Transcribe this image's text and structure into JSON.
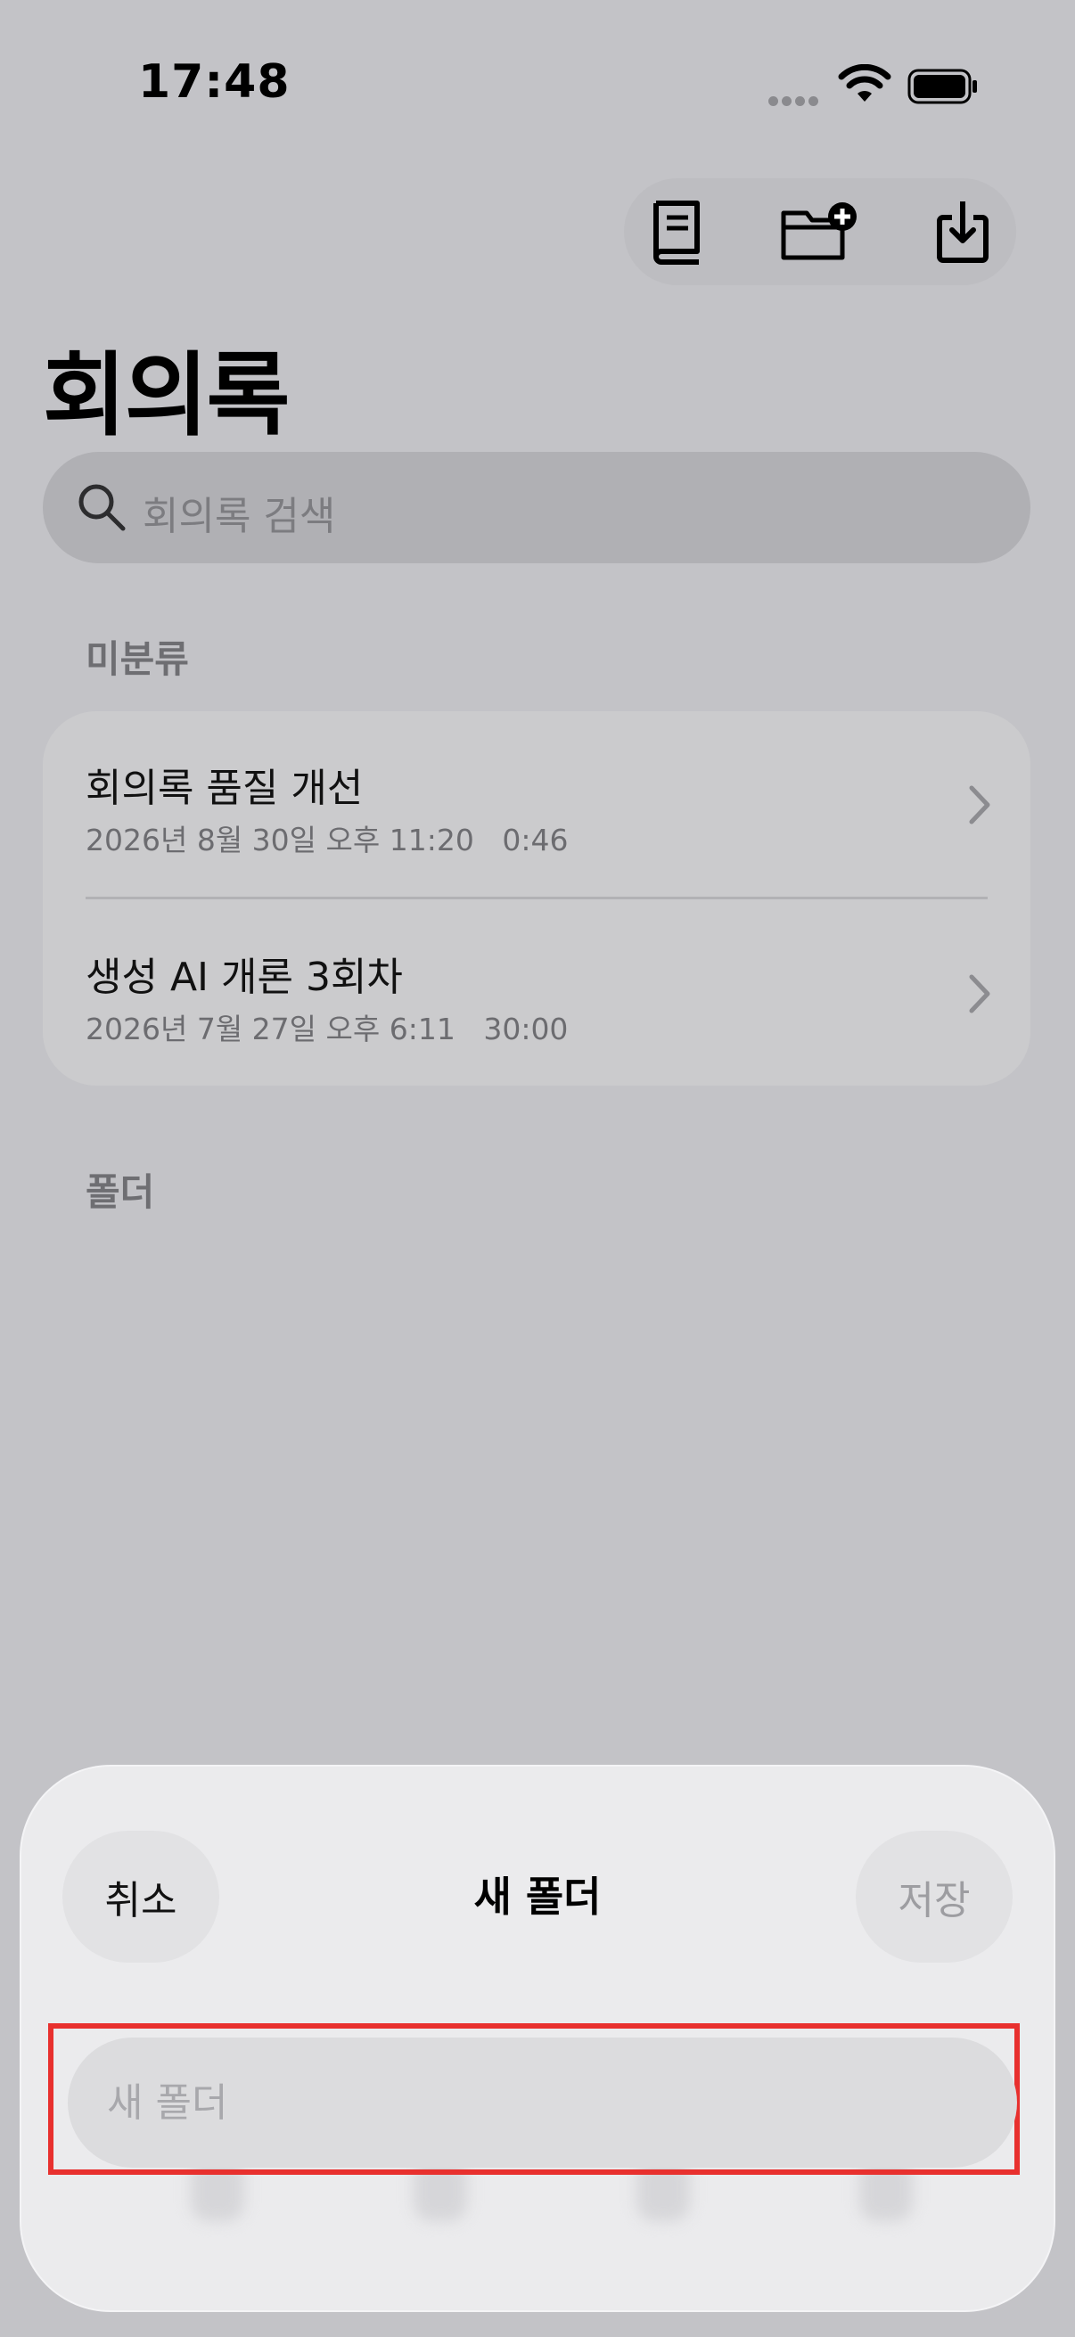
{
  "status_bar": {
    "time": "17:48"
  },
  "header": {
    "title": "회의록"
  },
  "search": {
    "placeholder": "회의록 검색"
  },
  "sections": {
    "unsorted": "미분류",
    "folders": "폴더"
  },
  "notes": [
    {
      "title": "회의록 품질 개선",
      "date": "2026년 8월 30일 오후 11:20",
      "duration": "0:46"
    },
    {
      "title": "생성 AI 개론 3회차",
      "date": "2026년 7월 27일 오후 6:11",
      "duration": "30:00"
    }
  ],
  "sheet": {
    "title": "새 폴더",
    "cancel_label": "취소",
    "save_label": "저장",
    "input_placeholder": "새 폴더",
    "input_value": ""
  },
  "icons": {
    "toolbar": [
      "book-icon",
      "folder-plus-icon",
      "download-icon"
    ],
    "search": "search-icon",
    "row": "chevron-right-icon"
  },
  "colors": {
    "background": "#c3c3c7",
    "highlight": "#e8302e"
  }
}
